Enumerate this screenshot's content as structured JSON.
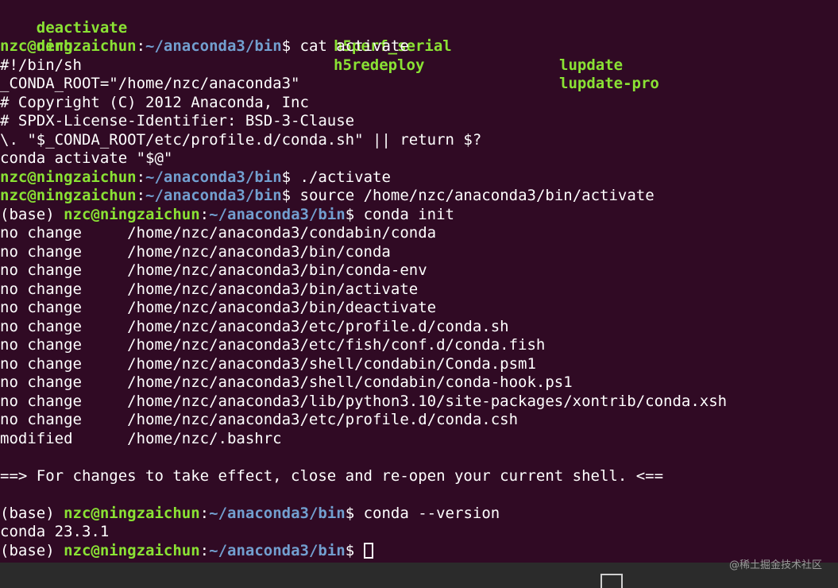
{
  "listing": {
    "rows": [
      {
        "c1": "deactivate",
        "c2": "h5perf_serial",
        "c3": "lupdate"
      },
      {
        "c1": "derb",
        "c2": "h5redeploy",
        "c3": "lupdate-pro"
      }
    ]
  },
  "prompt": {
    "user": "nzc@ningzaichun",
    "colon": ":",
    "path": "~/anaconda3/bin",
    "sigil": "$ ",
    "env": "(base) "
  },
  "commands": {
    "cat": "cat activate",
    "run": "./activate",
    "source": "source /home/nzc/anaconda3/bin/activate",
    "init": "conda init",
    "version": "conda --version"
  },
  "file_lines": [
    "#!/bin/sh",
    "_CONDA_ROOT=\"/home/nzc/anaconda3\"",
    "# Copyright (C) 2012 Anaconda, Inc",
    "# SPDX-License-Identifier: BSD-3-Clause",
    "\\. \"$_CONDA_ROOT/etc/profile.d/conda.sh\" || return $?",
    "conda activate \"$@\""
  ],
  "init_lines": [
    "no change     /home/nzc/anaconda3/condabin/conda",
    "no change     /home/nzc/anaconda3/bin/conda",
    "no change     /home/nzc/anaconda3/bin/conda-env",
    "no change     /home/nzc/anaconda3/bin/activate",
    "no change     /home/nzc/anaconda3/bin/deactivate",
    "no change     /home/nzc/anaconda3/etc/profile.d/conda.sh",
    "no change     /home/nzc/anaconda3/etc/fish/conf.d/conda.fish",
    "no change     /home/nzc/anaconda3/shell/condabin/Conda.psm1",
    "no change     /home/nzc/anaconda3/shell/condabin/conda-hook.ps1",
    "no change     /home/nzc/anaconda3/lib/python3.10/site-packages/xontrib/conda.xsh",
    "no change     /home/nzc/anaconda3/etc/profile.d/conda.csh",
    "modified      /home/nzc/.bashrc"
  ],
  "notice": "==> For changes to take effect, close and re-open your current shell. <==",
  "version_output": "conda 23.3.1",
  "watermark": "@稀土掘金技术社区",
  "icons": {
    "cursor": "block-cursor-icon",
    "edit": "edit-icon"
  },
  "colors": {
    "background": "#300a24",
    "user": "#8ae234",
    "path": "#729fcf",
    "text": "#ffffff"
  }
}
